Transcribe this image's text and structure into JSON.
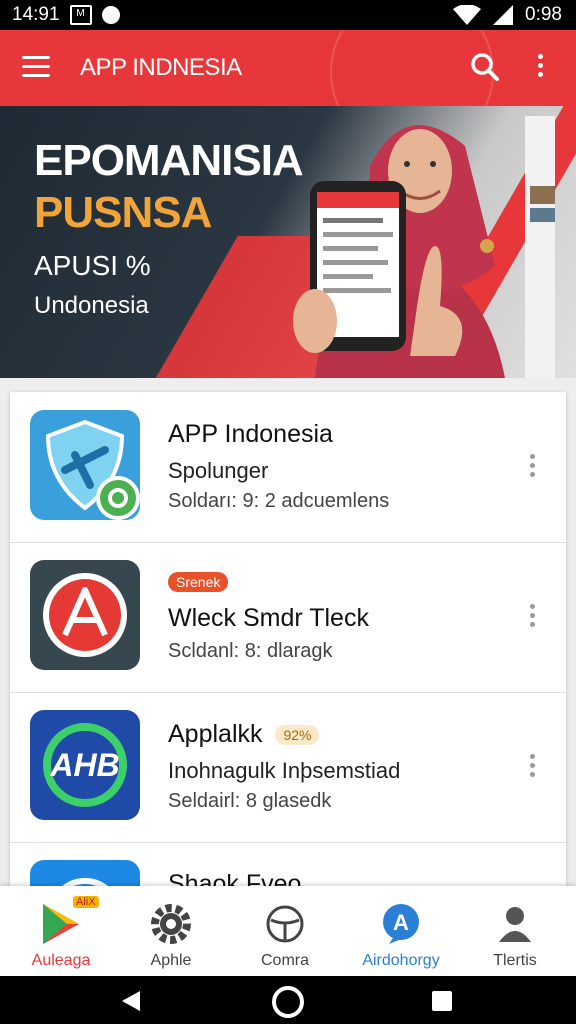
{
  "status_bar": {
    "time_left": "14:91",
    "time_right": "0:98"
  },
  "app_bar": {
    "title": "APP INDNESIA"
  },
  "banner": {
    "line1": "EPOMANISIA",
    "line2": "PUSNSA",
    "line3": "APUSI %",
    "line4": "Undonesia"
  },
  "apps": [
    {
      "name": "APP Indonesia",
      "badge": "",
      "subtitle": "Spolunger",
      "meta": "Soldarı: 9: 2 adcuemlens",
      "icon": "shield-app-icon"
    },
    {
      "name": "Wleck Smdr Tleck",
      "badge": "Srenek",
      "subtitle": "",
      "meta": "Scldanl: 8: dlaragk",
      "icon": "red-a-app-icon"
    },
    {
      "name": "Applalkk",
      "badge": "92%",
      "subtitle": "Inohnagulk Inþsemstiad",
      "meta": "Seldairl: 8 glasedk",
      "icon": "ahb-app-icon"
    },
    {
      "name": "Shaok Fveo",
      "badge": "",
      "subtitle": "",
      "meta": "",
      "icon": "partial-app-icon"
    }
  ],
  "bottom_nav": [
    {
      "label": "Auleaga",
      "badge": "AliX",
      "icon": "play-store-icon",
      "active": true
    },
    {
      "label": "Aphle",
      "icon": "gear-icon",
      "active": false
    },
    {
      "label": "Comra",
      "icon": "steering-icon",
      "active": false
    },
    {
      "label": "Airdohorgy",
      "icon": "a-chat-icon",
      "active": false
    },
    {
      "label": "Tlertis",
      "icon": "person-icon",
      "active": false
    }
  ],
  "colors": {
    "accent": "#e8373a",
    "active_label": "#e8373a",
    "blue_label": "#2b7fd6"
  }
}
